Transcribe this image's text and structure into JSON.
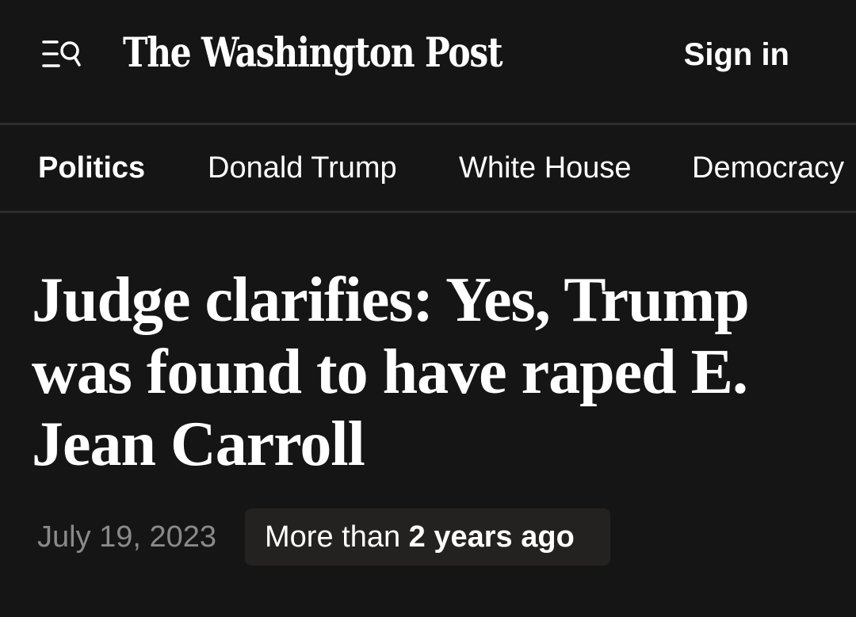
{
  "header": {
    "menu_icon": "menu-search-icon",
    "logo_text": "The Washington Post",
    "sign_in_label": "Sign in"
  },
  "nav": {
    "items": [
      {
        "label": "Politics",
        "active": true
      },
      {
        "label": "Donald Trump",
        "active": false
      },
      {
        "label": "White House",
        "active": false
      },
      {
        "label": "Democracy",
        "active": false
      }
    ]
  },
  "article": {
    "headline": "Judge clarifies: Yes, Trump was found to have raped E. Jean Carroll",
    "date": "July 19, 2023",
    "age_prefix": "More than ",
    "age_value": "2 years ago"
  },
  "colors": {
    "background": "#151515",
    "divider": "#2c2c2c",
    "text": "#ffffff",
    "muted_text": "#8a8a8a",
    "badge_background": "#232220"
  }
}
